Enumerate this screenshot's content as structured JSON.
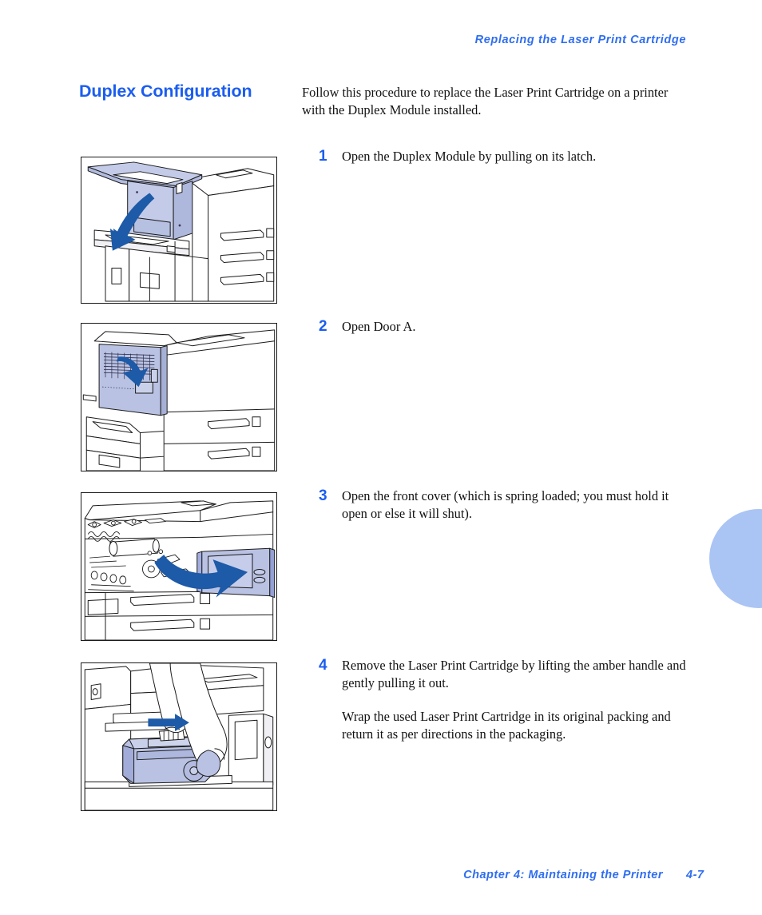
{
  "document": {
    "running_header": "Replacing the Laser Print Cartridge",
    "section_title": "Duplex Configuration",
    "intro": "Follow this procedure to replace the Laser Print Cartridge on a printer with the Duplex Module installed.",
    "footer": {
      "chapter": "Chapter 4: Maintaining the Printer",
      "page_number": "4-7"
    }
  },
  "colors": {
    "heading_blue": "#1b5df0",
    "header_blue": "#2f6ef0",
    "arrow_blue": "#1d5aa8",
    "panel_shade": "#b9c2e3",
    "tab_blue": "#aac4f4",
    "line_black": "#1a1a1a"
  },
  "steps": [
    {
      "number": "1",
      "text": "Open the Duplex Module by pulling on its latch.",
      "text2": "",
      "figure_alt": "Printer with duplex module being opened by its latch, curved arrow pointing down-left"
    },
    {
      "number": "2",
      "text": "Open Door A.",
      "text2": "",
      "figure_alt": "Printer side with Door A panel shaded, curved arrow pointing down"
    },
    {
      "number": "3",
      "text": "Open the front cover (which is spring loaded; you must hold it open or else it will shut).",
      "text2": "",
      "figure_alt": "Printer front cover open showing internal rollers, thick arrow curving up to the right"
    },
    {
      "number": "4",
      "text": "Remove the Laser Print Cartridge by lifting the amber handle and gently pulling it out.",
      "text2": "Wrap the used Laser Print Cartridge in its original packing and return it as per directions in the packaging.",
      "figure_alt": "Two hands lifting the amber handle and pulling the laser print cartridge out, straight arrow pointing right"
    }
  ]
}
